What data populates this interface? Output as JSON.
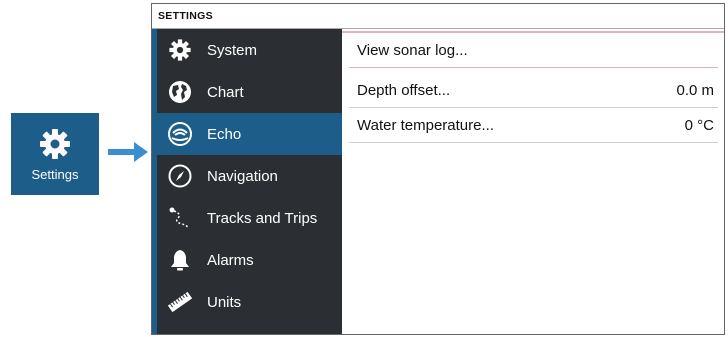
{
  "launcher": {
    "label": "Settings",
    "icon": "gear-icon",
    "color": "#1d5d8a"
  },
  "panel": {
    "title": "SETTINGS",
    "sidebar": {
      "items": [
        {
          "label": "System",
          "icon": "gear-icon",
          "active": false
        },
        {
          "label": "Chart",
          "icon": "globe-icon",
          "active": false
        },
        {
          "label": "Echo",
          "icon": "sonar-icon",
          "active": true
        },
        {
          "label": "Navigation",
          "icon": "compass-icon",
          "active": false
        },
        {
          "label": "Tracks and Trips",
          "icon": "track-icon",
          "active": false
        },
        {
          "label": "Alarms",
          "icon": "bell-icon",
          "active": false
        },
        {
          "label": "Units",
          "icon": "ruler-icon",
          "active": false
        }
      ]
    },
    "content": {
      "rows": [
        {
          "label": "View sonar log...",
          "value": ""
        },
        {
          "label": "Depth offset...",
          "value": "0.0 m"
        },
        {
          "label": "Water temperature...",
          "value": "0 °C"
        }
      ]
    }
  },
  "colors": {
    "accent": "#1d5d8a",
    "sidebar_bg": "#2b2f33",
    "highlight_line": "#e6b0ba"
  }
}
